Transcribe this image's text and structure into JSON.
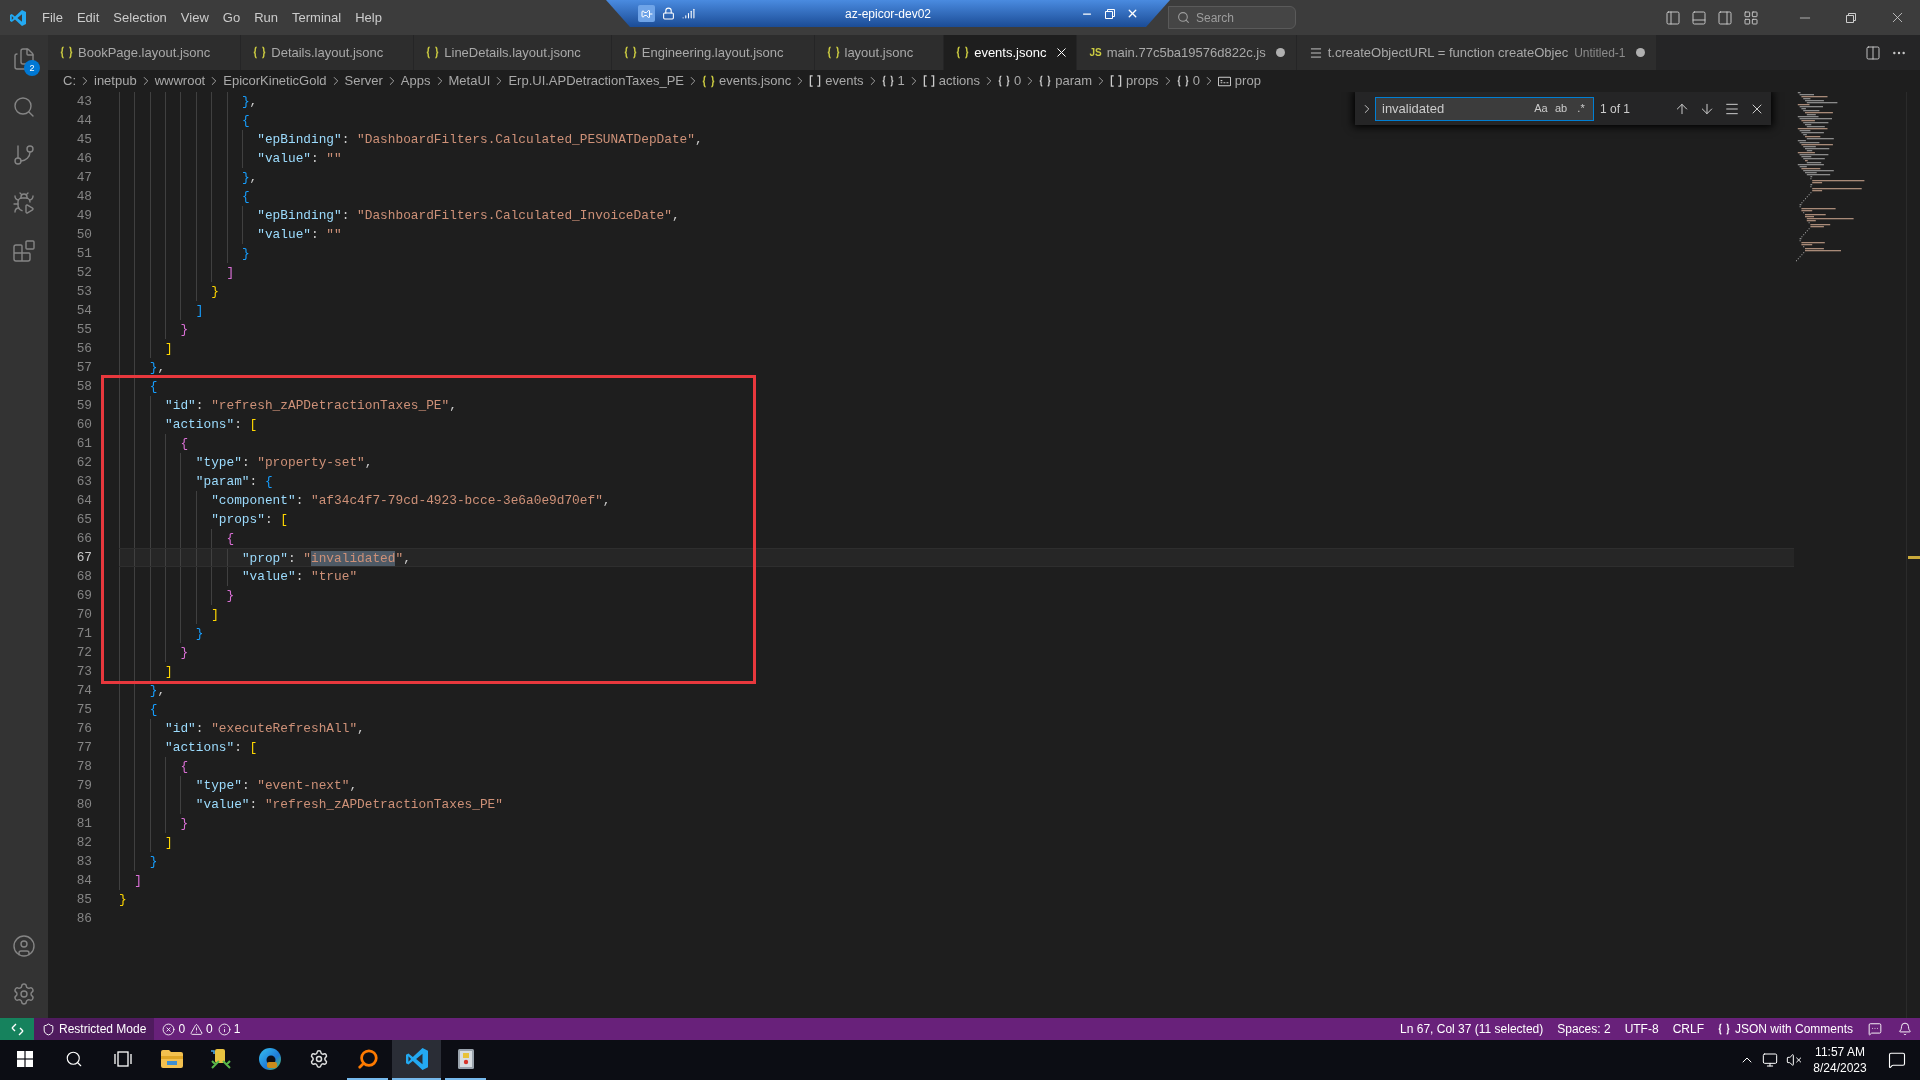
{
  "title_bar": {
    "menu": [
      "File",
      "Edit",
      "Selection",
      "View",
      "Go",
      "Run",
      "Terminal",
      "Help"
    ],
    "search": {
      "placeholder": "Search"
    }
  },
  "remote_session_bar": {
    "title": "az-epicor-dev02"
  },
  "activity_bar": {
    "items": [
      {
        "kind": "explorer",
        "badge": "2"
      },
      {
        "kind": "search"
      },
      {
        "kind": "source-control"
      },
      {
        "kind": "run-debug"
      },
      {
        "kind": "extensions"
      }
    ],
    "bottom": [
      {
        "kind": "account"
      },
      {
        "kind": "manage"
      }
    ]
  },
  "tabs": [
    {
      "kind": "json",
      "label": "BookPage.layout.jsonc",
      "selected": false,
      "dirty": false
    },
    {
      "kind": "json",
      "label": "Details.layout.jsonc",
      "selected": false,
      "dirty": false
    },
    {
      "kind": "json",
      "label": "LineDetails.layout.jsonc",
      "selected": false,
      "dirty": false
    },
    {
      "kind": "json",
      "label": "Engineering.layout.jsonc",
      "selected": false,
      "dirty": false
    },
    {
      "kind": "json",
      "label": "layout.jsonc",
      "selected": false,
      "dirty": false
    },
    {
      "kind": "json",
      "label": "events.jsonc",
      "selected": true,
      "dirty": false
    },
    {
      "kind": "js",
      "icon_label": "JS",
      "label": "main.77c5ba19576d822c.js",
      "selected": false,
      "dirty": true
    },
    {
      "kind": "text",
      "label": "t.createObjectURL = function createObjec",
      "description": "Untitled-1",
      "selected": false,
      "dirty": true
    }
  ],
  "breadcrumbs": [
    {
      "kind": "folder",
      "label": "C:"
    },
    {
      "kind": "folder",
      "label": "inetpub"
    },
    {
      "kind": "folder",
      "label": "wwwroot"
    },
    {
      "kind": "folder",
      "label": "EpicorKineticGold"
    },
    {
      "kind": "folder",
      "label": "Server"
    },
    {
      "kind": "folder",
      "label": "Apps"
    },
    {
      "kind": "folder",
      "label": "MetaUI"
    },
    {
      "kind": "folder",
      "label": "Erp.UI.APDetractionTaxes_PE"
    },
    {
      "kind": "file",
      "label": "events.jsonc"
    },
    {
      "kind": "array",
      "label": "events"
    },
    {
      "kind": "object",
      "label": "1"
    },
    {
      "kind": "array",
      "label": "actions"
    },
    {
      "kind": "object",
      "label": "0"
    },
    {
      "kind": "object",
      "label": "param"
    },
    {
      "kind": "array",
      "label": "props"
    },
    {
      "kind": "object",
      "label": "0"
    },
    {
      "kind": "string",
      "label": "prop"
    }
  ],
  "find_widget": {
    "value": "invalidated",
    "options": [
      {
        "label": "Aa",
        "on": false
      },
      {
        "label": "ab",
        "on": false
      },
      {
        "label": ".*",
        "on": false
      }
    ],
    "result": "1 of 1"
  },
  "editor": {
    "lines": [
      {
        "number": "43",
        "current": false,
        "text": "                },"
      },
      {
        "number": "44",
        "current": false,
        "text": "                {"
      },
      {
        "number": "45",
        "current": false,
        "text": "                  \"epBinding\": \"DashboardFilters.Calculated_PESUNATDepDate\","
      },
      {
        "number": "46",
        "current": false,
        "text": "                  \"value\": \"\""
      },
      {
        "number": "47",
        "current": false,
        "text": "                },"
      },
      {
        "number": "48",
        "current": false,
        "text": "                {"
      },
      {
        "number": "49",
        "current": false,
        "text": "                  \"epBinding\": \"DashboardFilters.Calculated_InvoiceDate\","
      },
      {
        "number": "50",
        "current": false,
        "text": "                  \"value\": \"\""
      },
      {
        "number": "51",
        "current": false,
        "text": "                }"
      },
      {
        "number": "52",
        "current": false,
        "text": "              ]"
      },
      {
        "number": "53",
        "current": false,
        "text": "            }"
      },
      {
        "number": "54",
        "current": false,
        "text": "          ]"
      },
      {
        "number": "55",
        "current": false,
        "text": "        }"
      },
      {
        "number": "56",
        "current": false,
        "text": "      ]"
      },
      {
        "number": "57",
        "current": false,
        "text": "    },"
      },
      {
        "number": "58",
        "current": false,
        "text": "    {"
      },
      {
        "number": "59",
        "current": false,
        "text": "      \"id\": \"refresh_zAPDetractionTaxes_PE\","
      },
      {
        "number": "60",
        "current": false,
        "text": "      \"actions\": ["
      },
      {
        "number": "61",
        "current": false,
        "text": "        {"
      },
      {
        "number": "62",
        "current": false,
        "text": "          \"type\": \"property-set\","
      },
      {
        "number": "63",
        "current": false,
        "text": "          \"param\": {"
      },
      {
        "number": "64",
        "current": false,
        "text": "            \"component\": \"af34c4f7-79cd-4923-bcce-3e6a0e9d70ef\","
      },
      {
        "number": "65",
        "current": false,
        "text": "            \"props\": ["
      },
      {
        "number": "66",
        "current": false,
        "text": "              {"
      },
      {
        "number": "67",
        "current": true,
        "text": "                \"prop\": \"",
        "match": "invalidated",
        "text_after": "\","
      },
      {
        "number": "68",
        "current": false,
        "text": "                \"value\": \"true\""
      },
      {
        "number": "69",
        "current": false,
        "text": "              }"
      },
      {
        "number": "70",
        "current": false,
        "text": "            ]"
      },
      {
        "number": "71",
        "current": false,
        "text": "          }"
      },
      {
        "number": "72",
        "current": false,
        "text": "        }"
      },
      {
        "number": "73",
        "current": false,
        "text": "      ]"
      },
      {
        "number": "74",
        "current": false,
        "text": "    },"
      },
      {
        "number": "75",
        "current": false,
        "text": "    {"
      },
      {
        "number": "76",
        "current": false,
        "text": "      \"id\": \"executeRefreshAll\","
      },
      {
        "number": "77",
        "current": false,
        "text": "      \"actions\": ["
      },
      {
        "number": "78",
        "current": false,
        "text": "        {"
      },
      {
        "number": "79",
        "current": false,
        "text": "          \"type\": \"event-next\","
      },
      {
        "number": "80",
        "current": false,
        "text": "          \"value\": \"refresh_zAPDetractionTaxes_PE\""
      },
      {
        "number": "81",
        "current": false,
        "text": "        }"
      },
      {
        "number": "82",
        "current": false,
        "text": "      ]"
      },
      {
        "number": "83",
        "current": false,
        "text": "    }"
      },
      {
        "number": "84",
        "current": false,
        "text": "  ]"
      },
      {
        "number": "85",
        "current": false,
        "text": "}"
      },
      {
        "number": "86",
        "current": false
      }
    ]
  },
  "status_bar": {
    "restricted_mode": "Restricted Mode",
    "problems": [
      {
        "kind": "error",
        "count": "0"
      },
      {
        "kind": "warning",
        "count": "0"
      },
      {
        "kind": "info",
        "count": "1"
      }
    ],
    "items": [
      {
        "kind": "text",
        "label": "Ln 67, Col 37 (11 selected)"
      },
      {
        "kind": "text",
        "label": "Spaces: 2"
      },
      {
        "kind": "text",
        "label": "UTF-8"
      },
      {
        "kind": "text",
        "label": "CRLF"
      },
      {
        "kind": "language",
        "label": "JSON with Comments"
      }
    ]
  },
  "taskbar": {
    "apps": [
      {
        "kind": "start",
        "running": false,
        "active": false
      },
      {
        "kind": "search",
        "running": false,
        "active": false
      },
      {
        "kind": "task-view",
        "running": false,
        "active": false
      },
      {
        "kind": "file-explorer",
        "running": false,
        "active": false
      },
      {
        "kind": "tools",
        "running": false,
        "active": false
      },
      {
        "kind": "browser",
        "running": false,
        "active": false
      },
      {
        "kind": "settings",
        "running": false,
        "active": false
      },
      {
        "kind": "magnifier",
        "running": true,
        "active": false
      },
      {
        "kind": "editor",
        "running": true,
        "active": true
      },
      {
        "kind": "app",
        "running": true,
        "active": false
      }
    ],
    "clock": {
      "time": "11:57 AM",
      "date": "8/24/2023"
    }
  }
}
